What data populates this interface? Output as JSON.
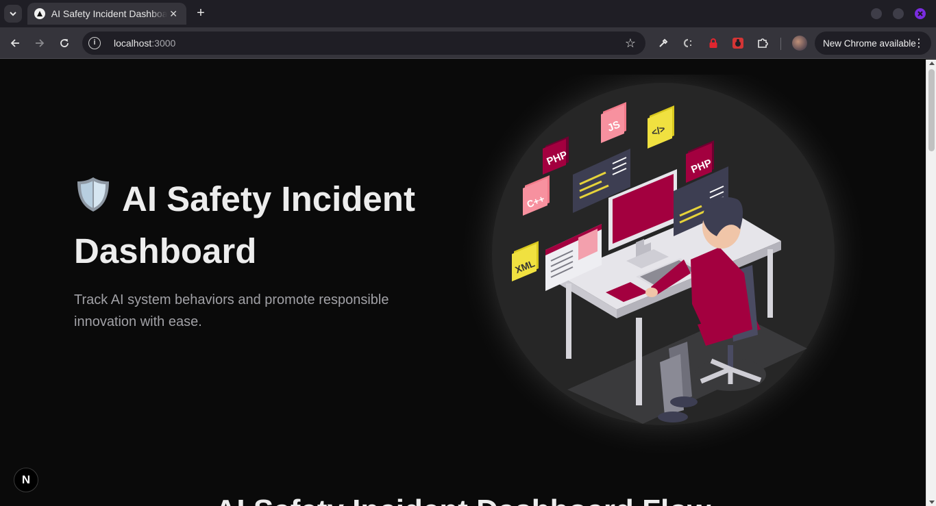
{
  "browser": {
    "tab_title": "AI Safety Incident Dashboard",
    "new_tab_label": "+",
    "tab_close_label": "✕",
    "url_host": "localhost",
    "url_port": ":3000",
    "update_label": "New Chrome available",
    "update_menu_label": "⋮"
  },
  "hero": {
    "title": "AI Safety Incident Dashboard",
    "subtitle": "Track AI system behaviors and promote responsible innovation with ease."
  },
  "illustration": {
    "tags": {
      "php_left": "PHP",
      "js": "JS",
      "html": "</>",
      "php_right": "PHP",
      "cpp": "C++",
      "xml": "XML"
    }
  },
  "dev_badge": "N",
  "flow_section": {
    "title": "AI Safety Incident Dashboard Flow"
  },
  "colors": {
    "accent": "#a3003f",
    "page_bg": "#0a0a0a",
    "chrome_bg": "#35343b"
  }
}
